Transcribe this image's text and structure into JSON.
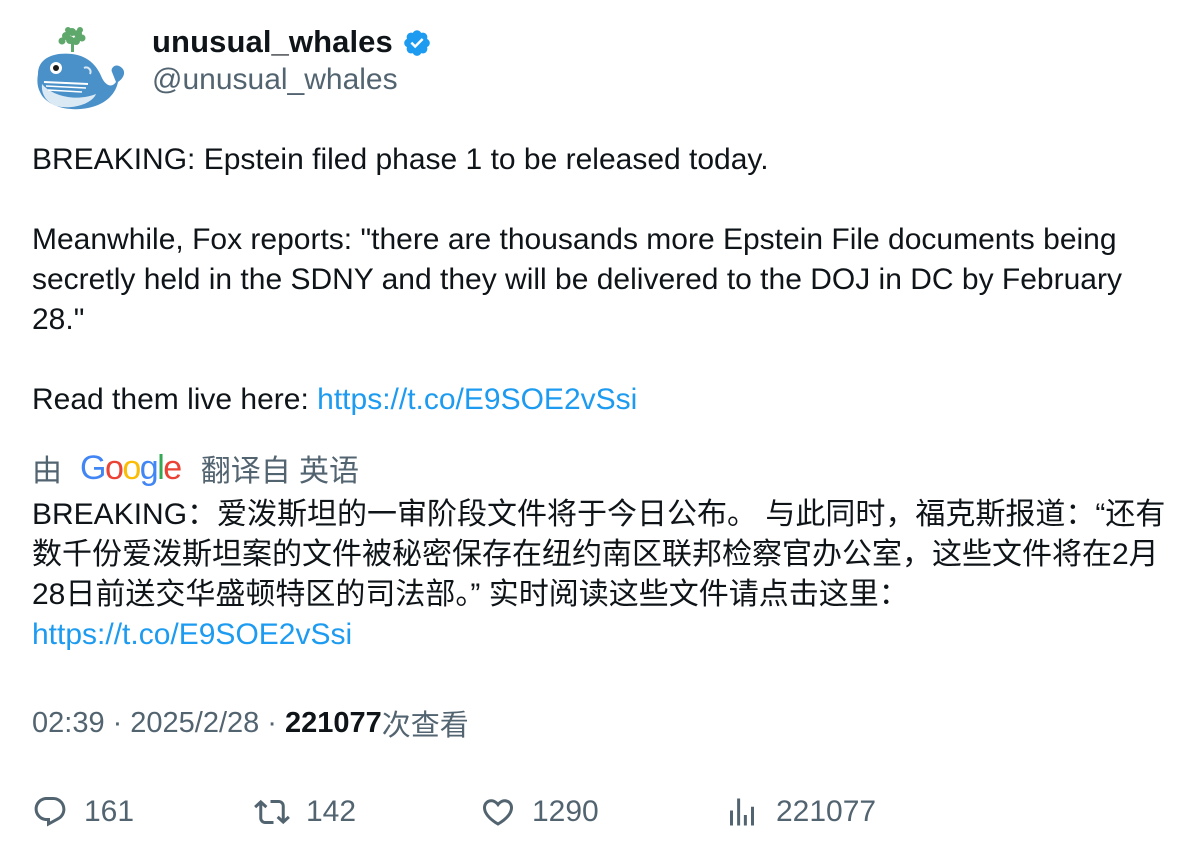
{
  "author": {
    "display_name": "unusual_whales",
    "handle": "@unusual_whales",
    "verified": true,
    "avatar_icon": "whale-avatar-icon",
    "verified_color": "#1d9bf0"
  },
  "tweet": {
    "line1": "BREAKING: Epstein filed phase 1 to be released today.",
    "line2": "Meanwhile, Fox reports: \"there are thousands more Epstein File documents being secretly held in the SDNY and they will be delivered to the DOJ in DC by February 28.\"",
    "line3_prefix": "Read them live here: ",
    "link": "https://t.co/E9SOE2vSsi"
  },
  "translation": {
    "by_label": "由",
    "provider": "Google",
    "from_label": "翻译自 英语",
    "text": "BREAKING：爱泼斯坦的一审阶段文件将于今日公布。 与此同时，福克斯报道：“还有数千份爱泼斯坦案的文件被秘密保存在纽约南区联邦检察官办公室，这些文件将在2月28日前送交华盛顿特区的司法部。” 实时阅读这些文件请点击这里：",
    "link": "https://t.co/E9SOE2vSsi"
  },
  "meta": {
    "time": "02:39",
    "separator": "·",
    "date": "2025/2/28",
    "views_count": "221077",
    "views_label": "次查看"
  },
  "actions": {
    "replies": "161",
    "retweets": "142",
    "likes": "1290",
    "views": "221077"
  },
  "colors": {
    "text_primary": "#0f1419",
    "text_secondary": "#536471",
    "link": "#1d9bf0"
  }
}
